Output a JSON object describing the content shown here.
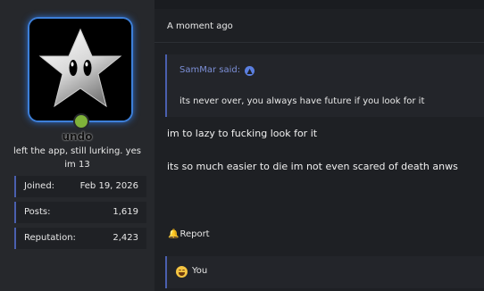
{
  "user": {
    "username": "undo",
    "title": "left the app, still lurking. yes im 13",
    "online": true,
    "stats": [
      {
        "label": "Joined:",
        "value": "Feb 19, 2026"
      },
      {
        "label": "Posts:",
        "value": "1,619"
      },
      {
        "label": "Reputation:",
        "value": "2,423"
      }
    ]
  },
  "post": {
    "timestamp": "A moment ago",
    "quote": {
      "author_line": "SamMar said:",
      "text": "its never over, you always have future if you look for it"
    },
    "lines": [
      "im to lazy to fucking look for it",
      "its so much easier to die im not even scared of death anws"
    ],
    "report_label": "Report",
    "reaction": {
      "user": "You",
      "emoji": "grinning-sweat"
    }
  },
  "colors": {
    "accent": "#4a5fae",
    "online": "#7fb23a",
    "avatar_glow": "#3d7fd8",
    "quote_author": "#7c8fd6"
  },
  "icons": {
    "quote_link": "arrow-up-circle-icon",
    "report": "bell-icon"
  }
}
